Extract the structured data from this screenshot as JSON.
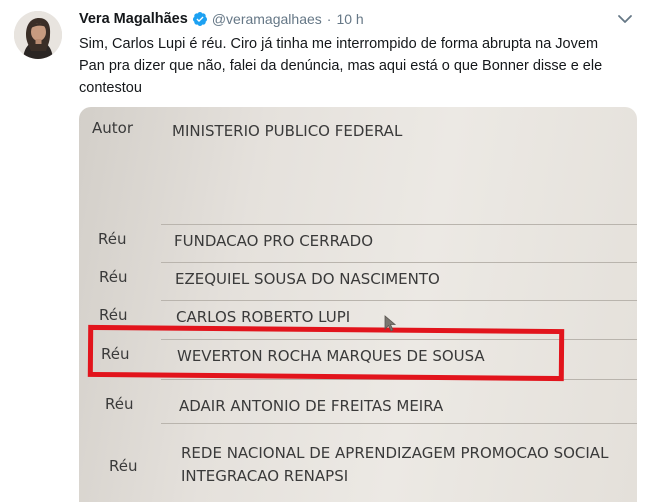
{
  "tweet": {
    "author": {
      "display_name": "Vera Magalhães",
      "handle": "@veramagalhaes",
      "verified": true
    },
    "separator": "·",
    "timestamp": "10 h",
    "text_lines": [
      "Sim, Carlos Lupi é réu. Ciro já tinha me interrompido de forma abrupta na Jovem",
      "Pan pra dizer que não, falei da denúncia, mas aqui está o que Bonner disse e ele",
      "contestou"
    ],
    "icons": {
      "avatar": "avatar-photo",
      "verified": "verified-badge-icon",
      "menu": "chevron-down-icon"
    }
  },
  "photo": {
    "author_row": {
      "role": "Autor",
      "party": "MINISTERIO PUBLICO FEDERAL"
    },
    "defendants": [
      {
        "role": "Réu",
        "party": "FUNDACAO PRO CERRADO"
      },
      {
        "role": "Réu",
        "party": "EZEQUIEL SOUSA DO NASCIMENTO"
      },
      {
        "role": "Réu",
        "party": "CARLOS ROBERTO LUPI"
      },
      {
        "role": "Réu",
        "party": "WEVERTON ROCHA MARQUES DE SOUSA",
        "highlighted": true
      },
      {
        "role": "Réu",
        "party": "ADAIR ANTONIO DE FREITAS MEIRA"
      },
      {
        "role": "Réu",
        "party": "REDE NACIONAL DE APRENDIZAGEM PROMOCAO SOCIAL",
        "party_line_2": "INTEGRACAO RENAPSI"
      }
    ],
    "highlight_color": "#e2141c"
  },
  "colors": {
    "name": "#14171a",
    "secondary": "#657786",
    "verified": "#1da1f2"
  }
}
